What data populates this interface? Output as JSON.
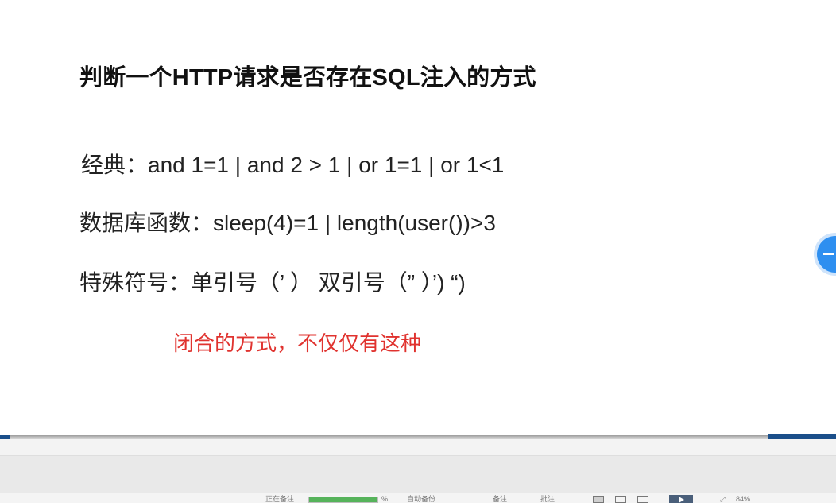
{
  "slide": {
    "title": "判断一个HTTP请求是否存在SQL注入的方式",
    "line_classic": "经典：and 1=1 | and 2 > 1 | or 1=1 | or 1<1",
    "line_db_func": "数据库函数：sleep(4)=1 | length(user())>3",
    "line_special": "特殊符号：单引号（’ ） 双引号（” ）’) “)",
    "note": "闭合的方式，不仅仅有这种"
  },
  "statusbar": {
    "left_label": "正在备注",
    "progress_percent": 100,
    "progress_label": "%",
    "middle_label": "自动备份",
    "notes_label": "备注",
    "comments_label": "批注",
    "zoom_label": "84%"
  },
  "colors": {
    "note_red": "#e0332f",
    "float_button_blue": "#2e8ff0",
    "accent_blue": "#1b4f8a",
    "progress_green": "#56b35b"
  },
  "icons": {
    "float_button": "collapse-icon",
    "play": "play-icon"
  }
}
